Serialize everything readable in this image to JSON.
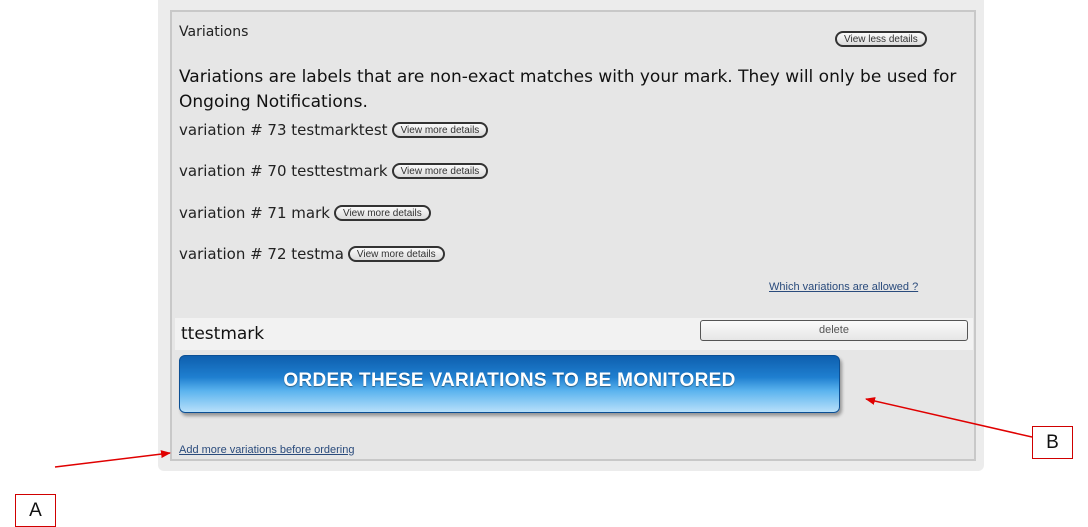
{
  "section": {
    "title": "Variations",
    "view_less_label": "View less details",
    "description": "Variations are labels that are non-exact matches with your mark. They will only be used for Ongoing Notifications."
  },
  "variations": [
    {
      "label": "variation # 73 testmarktest",
      "details_label": "View more details"
    },
    {
      "label": "variation # 70 testtestmark",
      "details_label": "View more details"
    },
    {
      "label": "variation # 71 mark",
      "details_label": "View more details"
    },
    {
      "label": "variation # 72 testma",
      "details_label": "View more details"
    }
  ],
  "allowed_link": "Which variations are allowed ?",
  "pending_item": {
    "name": "ttestmark",
    "delete_label": "delete"
  },
  "order_button_label": "ORDER THESE VARIATIONS TO BE MONITORED",
  "add_more_link": "Add more variations before ordering",
  "annotations": {
    "a_label": "A",
    "b_label": "B",
    "arrow_color": "#e00000"
  },
  "colors": {
    "panel_bg": "#e6e6e6",
    "order_button_top": "#0e5fae",
    "order_button_bottom": "#b7e0fa",
    "link": "#2a4b7c"
  }
}
